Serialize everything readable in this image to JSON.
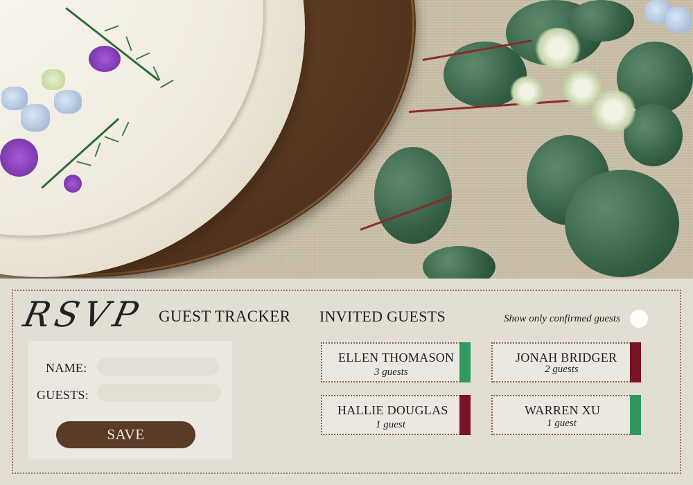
{
  "app": {
    "logo_text": "RSVP",
    "title": "GUEST TRACKER"
  },
  "form": {
    "name_label": "NAME:",
    "name_value": "",
    "guests_label": "GUESTS:",
    "guests_value": "",
    "save_label": "SAVE"
  },
  "guests_section": {
    "title": "INVITED GUESTS",
    "filter_label": "Show only confirmed guests",
    "filter_on": false
  },
  "guests": [
    {
      "name": "ELLEN THOMASON",
      "count_text": "3 guests",
      "confirmed": true
    },
    {
      "name": "JONAH BRIDGER",
      "count_text": "2 guests",
      "confirmed": false
    },
    {
      "name": "HALLIE DOUGLAS",
      "count_text": "1 guest",
      "confirmed": false
    },
    {
      "name": "WARREN XU",
      "count_text": "1 guest",
      "confirmed": true
    }
  ],
  "colors": {
    "confirmed": "#2e9a5f",
    "declined": "#7a1228",
    "button": "#5a3b28",
    "card_border": "#9d6f5a"
  },
  "hero_image": "cake-with-greenery-photo"
}
